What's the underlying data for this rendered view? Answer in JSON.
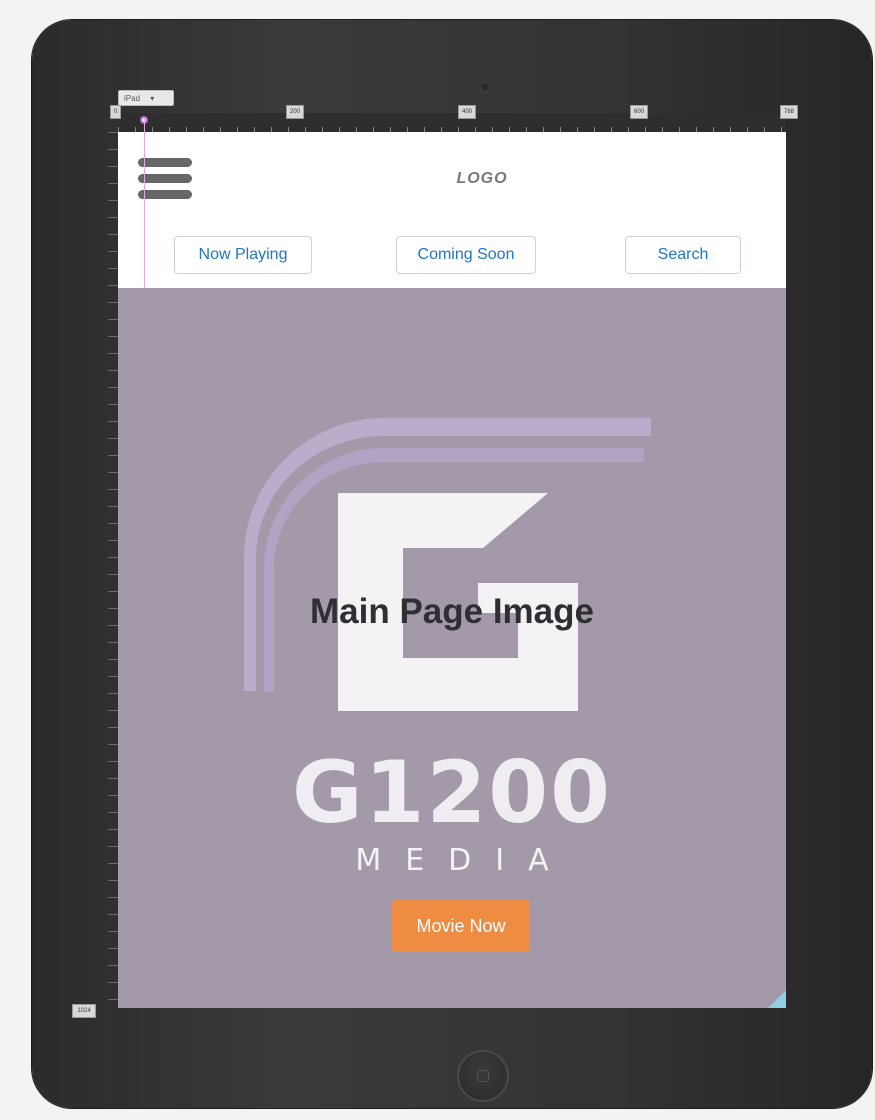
{
  "designer": {
    "device_select": "iPad",
    "ruler_marks": [
      "0",
      "200",
      "400",
      "600",
      "768"
    ],
    "height_tag": "1024"
  },
  "header": {
    "logo": "LOGO",
    "nav": [
      {
        "label": "Now Playing"
      },
      {
        "label": "Coming Soon"
      },
      {
        "label": "Search"
      }
    ]
  },
  "hero": {
    "label": "Main Page Image",
    "brand_wordmark": "G1200",
    "brand_sub": "MEDIA",
    "cta_label": "Movie Now"
  },
  "colors": {
    "nav_text": "#1f76c6",
    "hero_bg": "#a499a8",
    "cta_bg": "#ef8c43"
  },
  "icons": [
    "hamburger-menu-icon",
    "camera-icon",
    "home-button-icon",
    "resize-grip-icon"
  ]
}
